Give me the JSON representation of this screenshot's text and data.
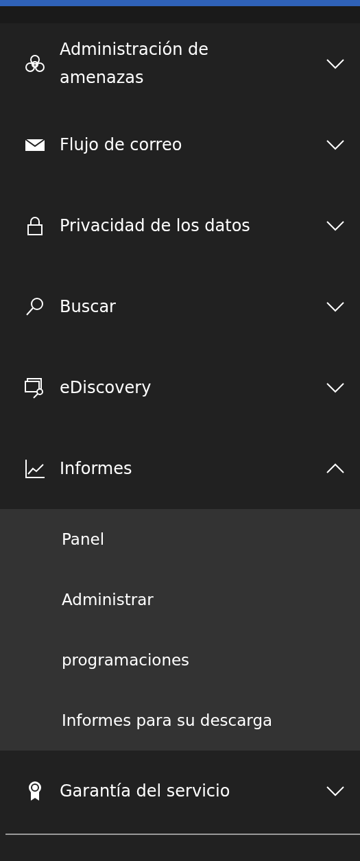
{
  "nav_items": [
    {
      "label": "Administración de amenazas",
      "expanded": false
    },
    {
      "label": "Flujo de correo",
      "expanded": false
    },
    {
      "label": "Privacidad de los datos",
      "expanded": false
    },
    {
      "label": "Buscar",
      "expanded": false
    },
    {
      "label": "eDiscovery",
      "expanded": false
    },
    {
      "label": "Informes",
      "expanded": true,
      "children": [
        {
          "label": "Panel"
        },
        {
          "label": "Administrar"
        },
        {
          "label": "programaciones"
        },
        {
          "label": "Informes para su descarga"
        }
      ]
    },
    {
      "label": "Garantía del servicio",
      "expanded": false
    }
  ]
}
